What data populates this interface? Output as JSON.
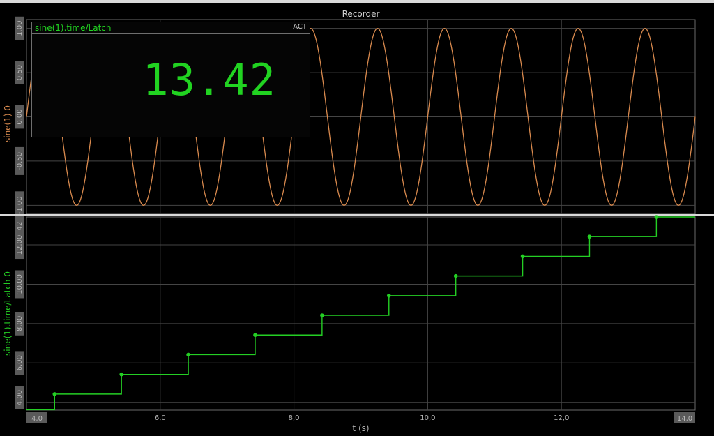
{
  "window": {
    "title": "Recorder"
  },
  "display": {
    "title": "sine(1).time/Latch",
    "mode": "ACT",
    "value": "13.42"
  },
  "colors": {
    "sine": "#d98a4e",
    "latch": "#24cf24",
    "grid": "#454545",
    "background": "#000000"
  },
  "chart_data": [
    {
      "type": "line",
      "name": "top-recorder",
      "title": "Recorder",
      "ylabel": "sine(1) 0",
      "ylim": [
        -1.1,
        1.1
      ],
      "yticks": [
        "1.00",
        "0.50",
        "0.00",
        "-0.50",
        "-1.00"
      ],
      "ytick_values": [
        1.0,
        0.5,
        0.0,
        -0.5,
        -1.0
      ],
      "xlim": [
        4.0,
        14.0
      ],
      "grid": true,
      "series": [
        {
          "name": "sine(1)",
          "function": "sine",
          "amplitude": 1.0,
          "frequency_hz": 1.0,
          "phase_deg": 0
        }
      ]
    },
    {
      "type": "line",
      "name": "bottom-recorder",
      "xlabel": "t (s)",
      "ylabel": "sine(1).time/Latch 0",
      "xlim": [
        4.0,
        14.0
      ],
      "ylim": [
        3.6,
        13.42
      ],
      "xticks": [
        "4,0",
        "6,0",
        "8,0",
        "10,0",
        "12,0",
        "14,0"
      ],
      "xtick_values": [
        4.0,
        6.0,
        8.0,
        10.0,
        12.0,
        14.0
      ],
      "yticks": [
        "13,42",
        "12,00",
        "10,00",
        "8,00",
        "6,00",
        "4,00"
      ],
      "ytick_values": [
        13.42,
        12.0,
        10.0,
        8.0,
        6.0,
        4.0
      ],
      "grid": true,
      "series": [
        {
          "name": "sine(1).time/Latch",
          "step": true,
          "x": [
            4.0,
            4.42,
            5.42,
            6.42,
            7.42,
            8.42,
            9.42,
            10.42,
            11.42,
            12.42,
            13.42,
            14.0
          ],
          "y": [
            3.62,
            4.42,
            5.42,
            6.42,
            7.42,
            8.42,
            9.42,
            10.42,
            11.42,
            12.42,
            13.42,
            13.42
          ],
          "markers_x": [
            4.42,
            5.42,
            6.42,
            7.42,
            8.42,
            9.42,
            10.42,
            11.42,
            12.42,
            13.42
          ],
          "markers_y": [
            4.42,
            5.42,
            6.42,
            7.42,
            8.42,
            9.42,
            10.42,
            11.42,
            12.42,
            13.42
          ]
        }
      ]
    }
  ]
}
